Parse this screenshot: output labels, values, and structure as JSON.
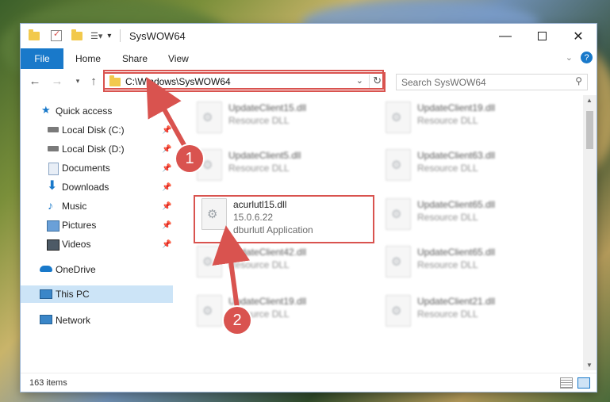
{
  "window": {
    "title": "SysWOW64"
  },
  "ribbon": {
    "file": "File",
    "tabs": [
      "Home",
      "Share",
      "View"
    ]
  },
  "address": {
    "path": "C:\\Windows\\SysWOW64"
  },
  "search": {
    "placeholder": "Search SysWOW64"
  },
  "sidebar": {
    "items": [
      {
        "label": "Quick access",
        "icon": "star-icon"
      },
      {
        "label": "Local Disk (C:)",
        "icon": "drive-icon"
      },
      {
        "label": "Local Disk (D:)",
        "icon": "drive-icon"
      },
      {
        "label": "Documents",
        "icon": "documents-icon"
      },
      {
        "label": "Downloads",
        "icon": "download-icon"
      },
      {
        "label": "Music",
        "icon": "music-icon"
      },
      {
        "label": "Pictures",
        "icon": "pictures-icon"
      },
      {
        "label": "Videos",
        "icon": "videos-icon"
      },
      {
        "label": "OneDrive",
        "icon": "cloud-icon"
      },
      {
        "label": "This PC",
        "icon": "computer-icon"
      },
      {
        "label": "Network",
        "icon": "network-icon"
      }
    ]
  },
  "files": [
    {
      "name": "UpdateClient15.dll",
      "detail": "Resource DLL"
    },
    {
      "name": "UpdateClient19.dll",
      "detail": "Resource DLL"
    },
    {
      "name": "UpdateClient5.dll",
      "detail": "Resource DLL"
    },
    {
      "name": "UpdateClient63.dll",
      "detail": "Resource DLL"
    },
    {
      "name": "acurlutl15.dll",
      "version": "15.0.6.22",
      "detail": "dburlutl Application"
    },
    {
      "name": "UpdateClient65.dll",
      "detail": "Resource DLL"
    },
    {
      "name": "UpdateClient42.dll",
      "detail": "Resource DLL"
    },
    {
      "name": "UpdateClient65.dll",
      "detail": "Resource DLL"
    },
    {
      "name": "UpdateClient19.dll",
      "detail": "Resource DLL"
    },
    {
      "name": "UpdateClient21.dll",
      "detail": "Resource DLL"
    }
  ],
  "status": {
    "count": "163 items"
  },
  "annotations": {
    "badge1": "1",
    "badge2": "2"
  },
  "colors": {
    "accent": "#1979ca",
    "highlight": "#d9534f"
  }
}
